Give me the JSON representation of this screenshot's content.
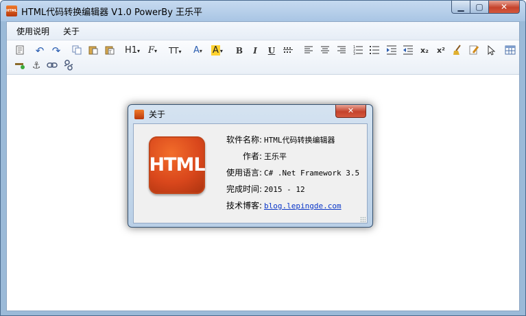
{
  "window": {
    "title": "HTML代码转换编辑器 V1.0  PowerBy 王乐平",
    "icon_label": "HTML"
  },
  "menu": {
    "items": [
      "使用说明",
      "关于"
    ]
  },
  "toolbar": {
    "heading_label": "H1",
    "font_label": "F",
    "fontsize_label": "TT",
    "forecolor_label": "A",
    "backcolor_label": "A",
    "bold_label": "B",
    "italic_label": "I",
    "underline_label": "U",
    "subscript_label": "x₂",
    "superscript_label": "x²",
    "icons": [
      "source-icon",
      "undo-icon",
      "redo-icon",
      "copy-icon",
      "paste-icon",
      "paste-text-icon",
      "heading-icon",
      "font-family-icon",
      "font-size-icon",
      "font-color-icon",
      "highlight-color-icon",
      "bold-icon",
      "italic-icon",
      "underline-icon",
      "strikethrough-icon",
      "align-left-icon",
      "align-center-icon",
      "align-right-icon",
      "ordered-list-icon",
      "unordered-list-icon",
      "indent-icon",
      "outdent-icon",
      "subscript-icon",
      "superscript-icon",
      "clear-format-icon",
      "format-painter-icon",
      "select-icon",
      "table-icon",
      "horizontal-rule-icon",
      "anchor-icon",
      "link-icon",
      "unlink-icon"
    ]
  },
  "about_dialog": {
    "title": "关于",
    "logo_text": "HTML",
    "rows": [
      {
        "label": "软件名称:",
        "value": "HTML代码转换编辑器"
      },
      {
        "label": "作者:",
        "value": "王乐平"
      },
      {
        "label": "使用语言:",
        "value": "C# .Net Framework 3.5"
      },
      {
        "label": "完成时间:",
        "value": "2015 - 12"
      },
      {
        "label": "技术博客:",
        "value": "blog.lepingde.com"
      }
    ]
  },
  "colors": {
    "accent": "#d9471c",
    "link": "#0a36c8",
    "titlebar": "#b4cde8"
  }
}
